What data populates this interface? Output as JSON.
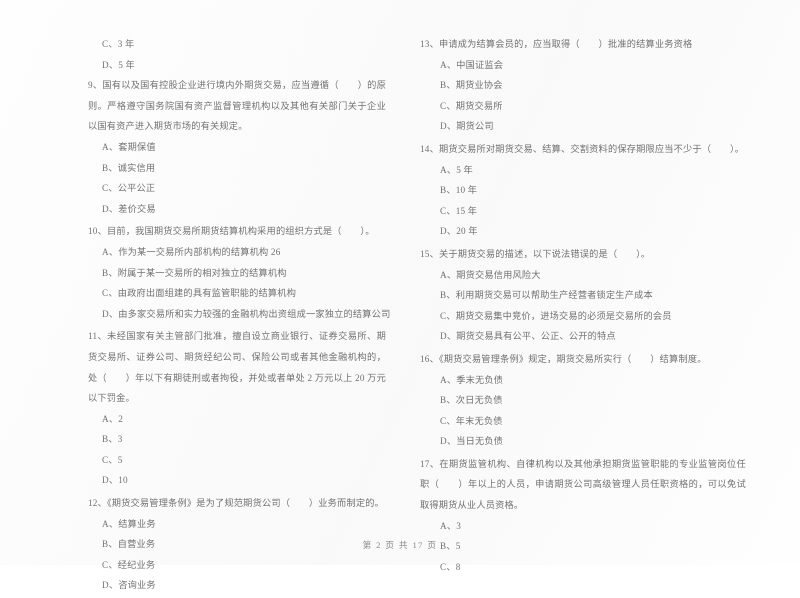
{
  "document": {
    "type": "exam-paper",
    "language": "zh-CN",
    "footer": "第 2 页 共 17 页"
  },
  "left_column": {
    "orphan_options": [
      "C、3 年",
      "D、5 年"
    ],
    "questions": [
      {
        "number": "9",
        "stem": "9、国有以及国有控股企业进行境内外期货交易，应当遵循（　　）的原则。严格遵守国务院国有资产监督管理机构以及其他有关部门关于企业以国有资产进入期货市场的有关规定。",
        "options": [
          "A、套期保值",
          "B、诚实信用",
          "C、公平公正",
          "D、差价交易"
        ]
      },
      {
        "number": "10",
        "stem": "10、目前，我国期货交易所期货结算机构采用的组织方式是（　　）。",
        "options": [
          "A、作为某一交易所内部机构的结算机构 26",
          "B、附属于某一交易所的相对独立的结算机构",
          "C、由政府出面组建的具有监管职能的结算机构",
          "D、由多家交易所和实力较强的金融机构出资组成一家独立的结算公司"
        ]
      },
      {
        "number": "11",
        "stem": "11、未经国家有关主管部门批准，擅自设立商业银行、证券交易所、期货交易所、证券公司、期货经纪公司、保险公司或者其他金融机构的，处（　　）年以下有期徒刑或者拘役，并处或者单处 2 万元以上 20 万元以下罚金。",
        "options": [
          "A、2",
          "B、3",
          "C、5",
          "D、10"
        ]
      },
      {
        "number": "12",
        "stem": "12、《期货交易管理条例》是为了规范期货公司（　　）业务而制定的。",
        "options": [
          "A、结算业务",
          "B、自营业务",
          "C、经纪业务",
          "D、咨询业务"
        ]
      }
    ]
  },
  "right_column": {
    "questions": [
      {
        "number": "13",
        "stem": "13、申请成为结算会员的，应当取得（　　）批准的结算业务资格",
        "options": [
          "A、中国证监会",
          "B、期货业协会",
          "C、期货交易所",
          "D、期货公司"
        ]
      },
      {
        "number": "14",
        "stem": "14、期货交易所对期货交易、结算、交割资料的保存期限应当不少于（　　）。",
        "options": [
          "A、5 年",
          "B、10 年",
          "C、15 年",
          "D、20 年"
        ]
      },
      {
        "number": "15",
        "stem": "15、关于期货交易的描述，以下说法错误的是（　　）。",
        "options": [
          "A、期货交易信用风险大",
          "B、利用期货交易可以帮助生产经营者锁定生产成本",
          "C、期货交易集中竞价，进场交易的必须是交易所的会员",
          "D、期货交易具有公平、公正、公开的特点"
        ]
      },
      {
        "number": "16",
        "stem": "16、《期货交易管理条例》规定，期货交易所实行（　　）结算制度。",
        "options": [
          "A、季末无负债",
          "B、次日无负债",
          "C、年末无负债",
          "D、当日无负债"
        ]
      },
      {
        "number": "17",
        "stem": "17、在期货监管机构、自律机构以及其他承担期货监管职能的专业监管岗位任职（　　）年以上的人员，申请期货公司高级管理人员任职资格的，可以免试取得期货从业人员资格。",
        "options": [
          "A、3",
          "B、5",
          "C、8"
        ]
      }
    ]
  }
}
